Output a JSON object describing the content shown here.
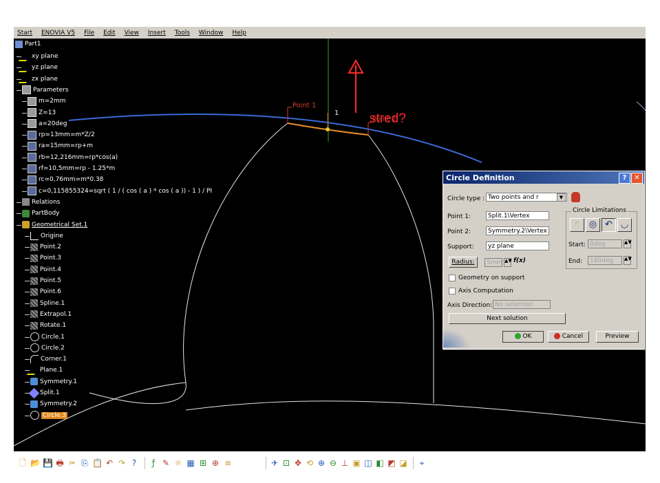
{
  "menu": [
    "Start",
    "ENOVIA V5",
    "File",
    "Edit",
    "View",
    "Insert",
    "Tools",
    "Window",
    "Help"
  ],
  "tree": {
    "root": "Part1",
    "items": [
      {
        "label": "xy plane",
        "icon": "plane-icon",
        "cls": "ico-plane"
      },
      {
        "label": "yz plane",
        "icon": "plane-icon",
        "cls": "ico-plane"
      },
      {
        "label": "zx plane",
        "icon": "plane-icon",
        "cls": "ico-plane"
      },
      {
        "label": "Parameters",
        "icon": "parameters-icon",
        "cls": "ico-param"
      },
      {
        "label": "m=2mm",
        "icon": "parameter-icon",
        "cls": "ico-param"
      },
      {
        "label": "Z=13",
        "icon": "parameter-icon",
        "cls": "ico-param"
      },
      {
        "label": "a=20deg",
        "icon": "parameter-icon",
        "cls": "ico-param"
      },
      {
        "label": "rp=13mm=m*Z/2",
        "icon": "formula-icon",
        "cls": "ico-formula"
      },
      {
        "label": "ra=15mm=rp+m",
        "icon": "formula-icon",
        "cls": "ico-formula"
      },
      {
        "label": "rb=12,216mm=rp*cos(a)",
        "icon": "formula-icon",
        "cls": "ico-formula"
      },
      {
        "label": "rf=10,5mm=rp - 1.25*m",
        "icon": "formula-icon",
        "cls": "ico-formula"
      },
      {
        "label": "rc=0,76mm=m*0.38",
        "icon": "formula-icon",
        "cls": "ico-formula"
      },
      {
        "label": "c=0,115855324=sqrt ( 1 / ( cos ( a ) * cos ( a )) - 1 ) / PI",
        "icon": "formula-icon",
        "cls": "ico-formula"
      },
      {
        "label": "Relations",
        "icon": "relations-icon",
        "cls": "ico-rel"
      },
      {
        "label": "PartBody",
        "icon": "partbody-icon",
        "cls": "ico-body"
      },
      {
        "label": "Geometrical Set.1",
        "icon": "geometrical-set-icon",
        "cls": "ico-set"
      },
      {
        "label": "Origine",
        "icon": "axis-icon",
        "cls": "ico-axis"
      },
      {
        "label": "Point.2",
        "icon": "point-icon",
        "cls": "ico-point"
      },
      {
        "label": "Point.3",
        "icon": "point-icon",
        "cls": "ico-point"
      },
      {
        "label": "Point.4",
        "icon": "point-icon",
        "cls": "ico-point"
      },
      {
        "label": "Point.5",
        "icon": "point-icon",
        "cls": "ico-point"
      },
      {
        "label": "Point.6",
        "icon": "point-icon",
        "cls": "ico-point"
      },
      {
        "label": "Spline.1",
        "icon": "spline-icon",
        "cls": "ico-point"
      },
      {
        "label": "Extrapol.1",
        "icon": "extrapol-icon",
        "cls": "ico-point"
      },
      {
        "label": "Rotate.1",
        "icon": "rotate-icon",
        "cls": "ico-point"
      },
      {
        "label": "Circle.1",
        "icon": "circle-icon",
        "cls": "ico-circle"
      },
      {
        "label": "Circle.2",
        "icon": "circle-icon",
        "cls": "ico-circle"
      },
      {
        "label": "Corner.1",
        "icon": "corner-icon",
        "cls": "ico-corner"
      },
      {
        "label": "Plane.1",
        "icon": "plane-icon",
        "cls": "ico-plane"
      },
      {
        "label": "Symmetry.1",
        "icon": "symmetry-icon",
        "cls": "ico-sym"
      },
      {
        "label": "Split.1",
        "icon": "split-icon",
        "cls": "ico-split"
      },
      {
        "label": "Symmetry.2",
        "icon": "symmetry-icon",
        "cls": "ico-sym"
      },
      {
        "label": "Circle.3",
        "icon": "circle-icon",
        "cls": "ico-circle"
      }
    ]
  },
  "annotation": "stred?",
  "labels": {
    "point1": "Point 1",
    "point2": "Point 2",
    "marker": "1"
  },
  "dialog": {
    "title": "Circle Definition",
    "circle_type_label": "Circle type :",
    "circle_type_value": "Two points and r",
    "point1_label": "Point 1:",
    "point1_value": "Split.1\\Vertex",
    "point2_label": "Point 2:",
    "point2_value": "Symmetry.2\\Vertex",
    "support_label": "Support:",
    "support_value": "yz plane",
    "radius_label": "Radius:",
    "radius_value": "5mm",
    "geometry_on_support": "Geometry on support",
    "axis_computation": "Axis Computation",
    "axis_direction_label": "Axis Direction:",
    "axis_direction_value": "No selection",
    "next_solution": "Next solution",
    "limits_title": "Circle Limitations",
    "start_label": "Start:",
    "start_value": "0deg",
    "end_label": "End:",
    "end_value": "180deg",
    "ok": "OK",
    "cancel": "Cancel",
    "preview": "Preview",
    "help_glyph": "?",
    "close_glyph": "✕",
    "formula_glyph": "f(x)"
  },
  "toolbar_icons": [
    "new-icon",
    "open-icon",
    "save-icon",
    "print-icon",
    "cut-icon",
    "copy-icon",
    "paste-icon",
    "undo-icon",
    "redo-icon",
    "whats-this-icon",
    "formula-icon",
    "comment-icon",
    "light-icon",
    "table-icon",
    "tree-icon",
    "catalog-icon",
    "spec-icon",
    "fly-icon",
    "fit-all-icon",
    "pan-icon",
    "rotate-icon",
    "zoom-in-icon",
    "zoom-out-icon",
    "normal-view-icon",
    "multi-view-icon",
    "iso-view-icon",
    "shading-icon",
    "hide-icon",
    "swap-icon",
    "compass-icon"
  ]
}
